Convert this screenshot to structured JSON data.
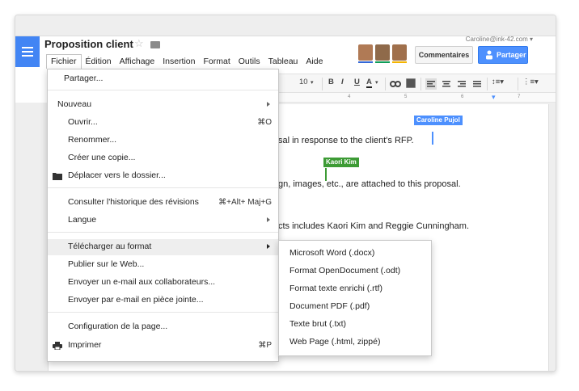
{
  "document": {
    "title": "Proposition client",
    "user_email": "Caroline@ink-42.com",
    "lines": [
      "sal in response to the client's RFP.",
      "gn, images, etc., are attached to this proposal.",
      "cts includes Kaori Kim and Reggie Cunningham."
    ]
  },
  "menubar": [
    "Fichier",
    "Édition",
    "Affichage",
    "Insertion",
    "Format",
    "Outils",
    "Tableau",
    "Aide"
  ],
  "header": {
    "comments_label": "Commentaires",
    "share_label": "Partager",
    "avatar_colors": [
      "#3367d6",
      "#0f9d58",
      "#f4b400"
    ]
  },
  "toolbar": {
    "font_size": "10",
    "bold": "B",
    "italic": "I",
    "underline": "U",
    "text_color": "A"
  },
  "ruler": [
    "4",
    "5",
    "6",
    "7"
  ],
  "collaborators": [
    {
      "name": "Caroline Pujol",
      "color": "#4d90fe"
    },
    {
      "name": "Kaori Kim",
      "color": "#3d9b35"
    }
  ],
  "file_menu": {
    "share": "Partager...",
    "new": "Nouveau",
    "open": "Ouvrir...",
    "open_shortcut": "⌘O",
    "rename": "Renommer...",
    "copy": "Créer une copie...",
    "move": "Déplacer vers le dossier...",
    "history": "Consulter l'historique des révisions",
    "history_shortcut": "⌘+Alt+ Maj+G",
    "language": "Langue",
    "download": "Télécharger au format",
    "publish": "Publier sur le Web...",
    "email_collab": "Envoyer un e-mail aux collaborateurs...",
    "email_attach": "Envoyer par e-mail en pièce jointe...",
    "page_setup": "Configuration de la page...",
    "print": "Imprimer",
    "print_shortcut": "⌘P"
  },
  "download_submenu": [
    "Microsoft Word (.docx)",
    "Format OpenDocument (.odt)",
    "Format texte enrichi (.rtf)",
    "Document PDF (.pdf)",
    "Texte brut (.txt)",
    "Web Page (.html, zippé)"
  ]
}
